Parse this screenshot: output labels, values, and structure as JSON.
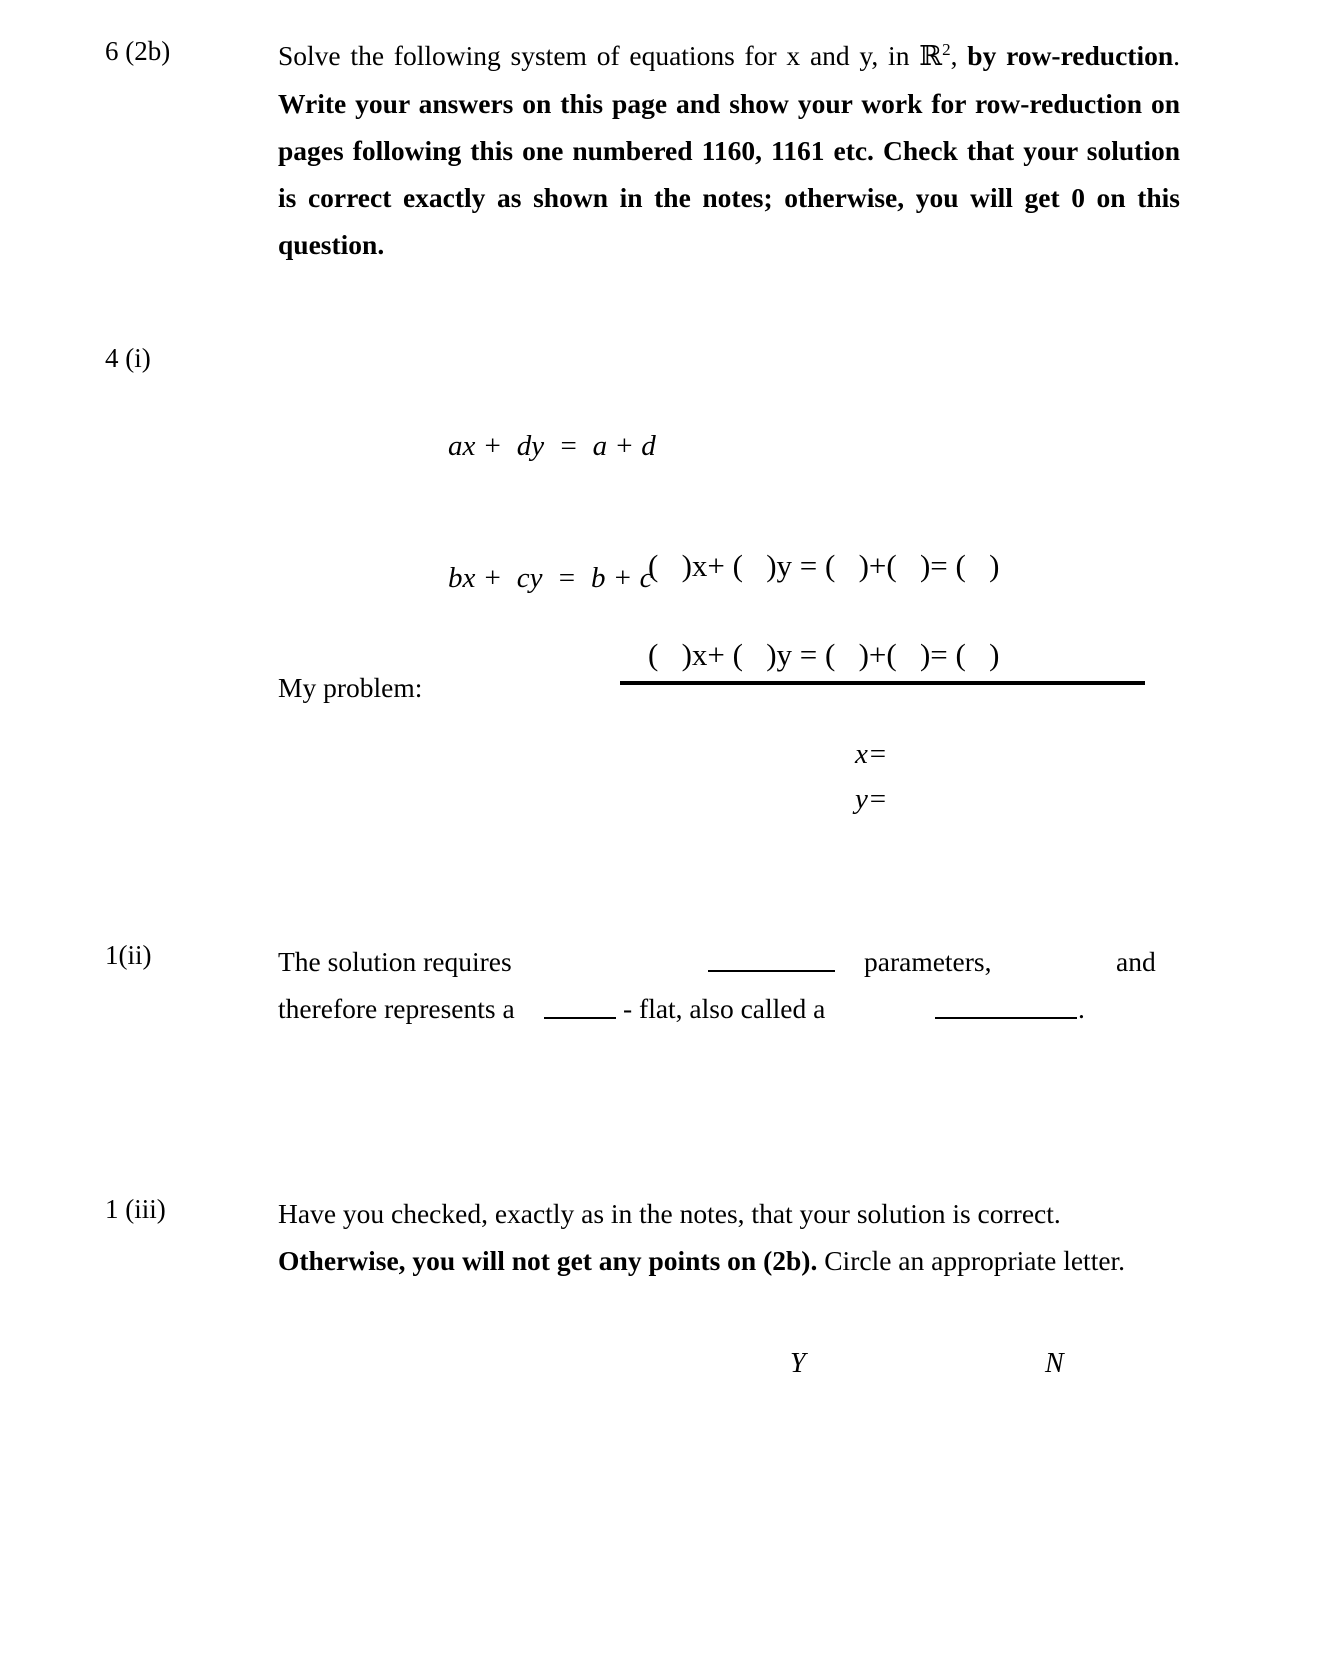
{
  "document": {
    "type": "exam-question-sheet",
    "background_color": "#ffffff",
    "text_color": "#000000"
  },
  "questions": [
    {
      "marker": "6 (2b)",
      "prompt_regular": "Solve the following system of equations for x and y, in ",
      "prompt_symbol": "ℝ",
      "prompt_symbol_sup": "2",
      "prompt_regular_tail": ",",
      "prompt_bold": "by row-reduction",
      "prompt_bold_period": ". ",
      "prompt_bold_rest": "Write your answers on this page and show your work for row-reduction on pages following this one numbered 1160, 1161 etc. Check that your solution is correct exactly as shown in the notes; otherwise, you will get 0 on this question."
    },
    {
      "marker": "4 (i)",
      "equations": [
        "ax +  dy  =  a + d",
        "bx +  cy  =  b + c"
      ],
      "template_lines": [
        "(   )x+ (   )y = (   )+(   )= (   )",
        "(   )x+ (   )y = (   )+(   )= (   )"
      ],
      "my_problem_label": "My problem:",
      "answers": [
        "x=",
        "y="
      ]
    },
    {
      "marker": "1(ii)",
      "line1_a": "The solution requires",
      "line1_b": "parameters,",
      "line1_c": "and",
      "line2_a": "therefore represents a",
      "line2_b": "- flat, also called a",
      "line2_c": "."
    },
    {
      "marker": "1 (iii)",
      "text_regular_1": "Have you checked, exactly as in the notes, that your solution is correct. ",
      "text_bold": "Otherwise, you will not get any points on (2b).",
      "text_regular_2": " Circle an appropriate letter.",
      "choice_yes": "Y",
      "choice_no": "N"
    }
  ]
}
